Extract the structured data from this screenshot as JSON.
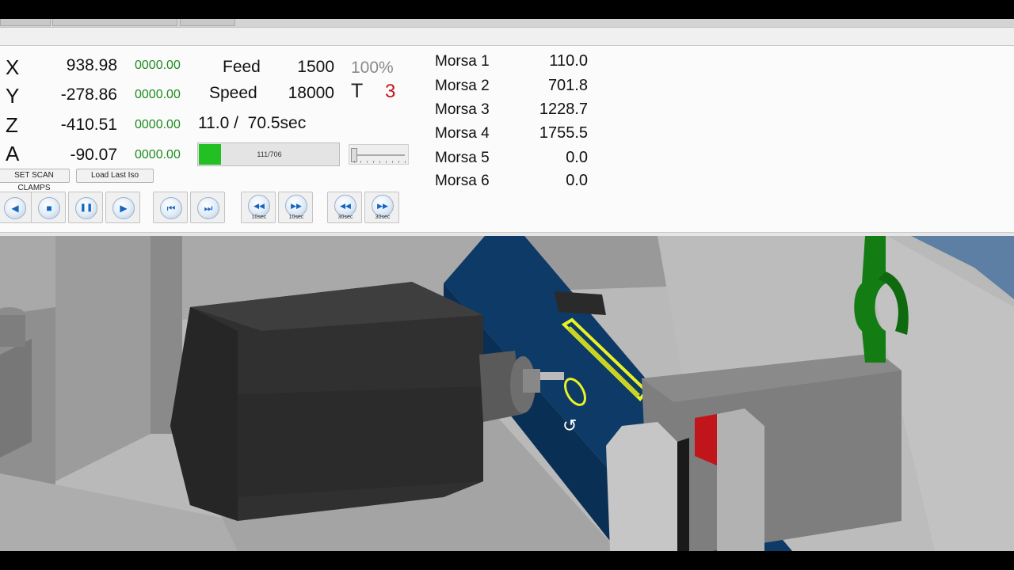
{
  "axes": [
    {
      "letter": "X",
      "value": "938.98",
      "dtg": "0000.00"
    },
    {
      "letter": "Y",
      "value": "-278.86",
      "dtg": "0000.00"
    },
    {
      "letter": "Z",
      "value": "-410.51",
      "dtg": "0000.00"
    },
    {
      "letter": "A",
      "value": "-90.07",
      "dtg": "0000.00"
    }
  ],
  "feed": {
    "label": "Feed",
    "value": "1500",
    "override": "100%"
  },
  "speed": {
    "label": "Speed",
    "value": "18000"
  },
  "tool": {
    "label": "T",
    "value": "3"
  },
  "time": "11.0 /  70.5sec",
  "progress": {
    "text": "111/706",
    "current": 111,
    "total": 706
  },
  "buttons": {
    "scan_clamps": "SET SCAN CLAMPS",
    "load_last_iso": "Load Last Iso"
  },
  "controls": {
    "back": "◀",
    "stop": "■",
    "pause": "❚❚",
    "play": "▶",
    "first": "⏮",
    "last": "⏭",
    "rew10": "◀◀",
    "fwd10": "▶▶",
    "rew30": "◀◀",
    "fwd30": "▶▶",
    "sub10": "10sec",
    "sub30": "30sec"
  },
  "morse": [
    {
      "name": "Morsa 1",
      "value": "110.0"
    },
    {
      "name": "Morsa 2",
      "value": "701.8"
    },
    {
      "name": "Morsa 3",
      "value": "1228.7"
    },
    {
      "name": "Morsa 4",
      "value": "1755.5"
    },
    {
      "name": "Morsa 5",
      "value": "0.0"
    },
    {
      "name": "Morsa 6",
      "value": "0.0"
    }
  ],
  "colors": {
    "dtg_green": "#1d8b1d",
    "tool_red": "#c0161b",
    "progress_green": "#23c023",
    "beam_blue": "#0d3a66",
    "clamp_green": "#137d13",
    "highlight_yellow": "#e8f226"
  }
}
